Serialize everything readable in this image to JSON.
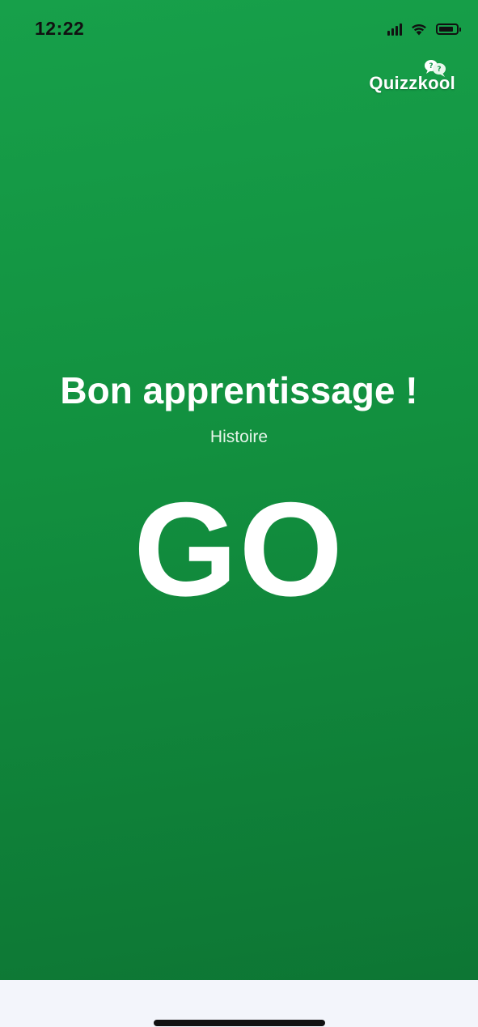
{
  "status_bar": {
    "time": "12:22",
    "icons": [
      "signal-icon",
      "wifi-icon",
      "battery-icon"
    ]
  },
  "logo": {
    "text": "Quizzkool",
    "icon": "question-bubbles-icon"
  },
  "main": {
    "title": "Bon apprentissage !",
    "subtitle": "Histoire",
    "go_label": "GO"
  },
  "colors": {
    "background_top": "#17a04a",
    "background_bottom": "#0d7634",
    "text": "#ffffff",
    "bottom_bar": "#f3f5fb"
  }
}
